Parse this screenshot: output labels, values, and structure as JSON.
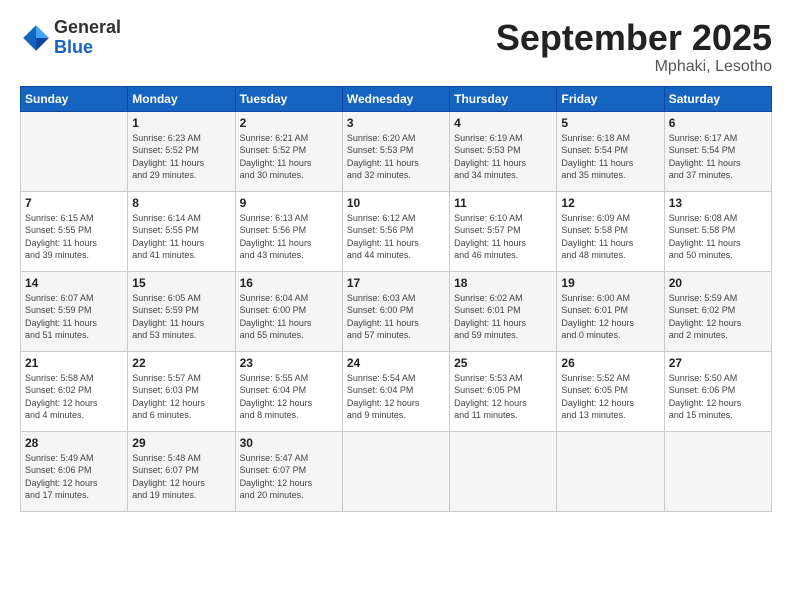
{
  "logo": {
    "general": "General",
    "blue": "Blue"
  },
  "title": "September 2025",
  "location": "Mphaki, Lesotho",
  "days_header": [
    "Sunday",
    "Monday",
    "Tuesday",
    "Wednesday",
    "Thursday",
    "Friday",
    "Saturday"
  ],
  "weeks": [
    [
      {
        "day": "",
        "info": ""
      },
      {
        "day": "1",
        "info": "Sunrise: 6:23 AM\nSunset: 5:52 PM\nDaylight: 11 hours\nand 29 minutes."
      },
      {
        "day": "2",
        "info": "Sunrise: 6:21 AM\nSunset: 5:52 PM\nDaylight: 11 hours\nand 30 minutes."
      },
      {
        "day": "3",
        "info": "Sunrise: 6:20 AM\nSunset: 5:53 PM\nDaylight: 11 hours\nand 32 minutes."
      },
      {
        "day": "4",
        "info": "Sunrise: 6:19 AM\nSunset: 5:53 PM\nDaylight: 11 hours\nand 34 minutes."
      },
      {
        "day": "5",
        "info": "Sunrise: 6:18 AM\nSunset: 5:54 PM\nDaylight: 11 hours\nand 35 minutes."
      },
      {
        "day": "6",
        "info": "Sunrise: 6:17 AM\nSunset: 5:54 PM\nDaylight: 11 hours\nand 37 minutes."
      }
    ],
    [
      {
        "day": "7",
        "info": "Sunrise: 6:15 AM\nSunset: 5:55 PM\nDaylight: 11 hours\nand 39 minutes."
      },
      {
        "day": "8",
        "info": "Sunrise: 6:14 AM\nSunset: 5:55 PM\nDaylight: 11 hours\nand 41 minutes."
      },
      {
        "day": "9",
        "info": "Sunrise: 6:13 AM\nSunset: 5:56 PM\nDaylight: 11 hours\nand 43 minutes."
      },
      {
        "day": "10",
        "info": "Sunrise: 6:12 AM\nSunset: 5:56 PM\nDaylight: 11 hours\nand 44 minutes."
      },
      {
        "day": "11",
        "info": "Sunrise: 6:10 AM\nSunset: 5:57 PM\nDaylight: 11 hours\nand 46 minutes."
      },
      {
        "day": "12",
        "info": "Sunrise: 6:09 AM\nSunset: 5:58 PM\nDaylight: 11 hours\nand 48 minutes."
      },
      {
        "day": "13",
        "info": "Sunrise: 6:08 AM\nSunset: 5:58 PM\nDaylight: 11 hours\nand 50 minutes."
      }
    ],
    [
      {
        "day": "14",
        "info": "Sunrise: 6:07 AM\nSunset: 5:59 PM\nDaylight: 11 hours\nand 51 minutes."
      },
      {
        "day": "15",
        "info": "Sunrise: 6:05 AM\nSunset: 5:59 PM\nDaylight: 11 hours\nand 53 minutes."
      },
      {
        "day": "16",
        "info": "Sunrise: 6:04 AM\nSunset: 6:00 PM\nDaylight: 11 hours\nand 55 minutes."
      },
      {
        "day": "17",
        "info": "Sunrise: 6:03 AM\nSunset: 6:00 PM\nDaylight: 11 hours\nand 57 minutes."
      },
      {
        "day": "18",
        "info": "Sunrise: 6:02 AM\nSunset: 6:01 PM\nDaylight: 11 hours\nand 59 minutes."
      },
      {
        "day": "19",
        "info": "Sunrise: 6:00 AM\nSunset: 6:01 PM\nDaylight: 12 hours\nand 0 minutes."
      },
      {
        "day": "20",
        "info": "Sunrise: 5:59 AM\nSunset: 6:02 PM\nDaylight: 12 hours\nand 2 minutes."
      }
    ],
    [
      {
        "day": "21",
        "info": "Sunrise: 5:58 AM\nSunset: 6:02 PM\nDaylight: 12 hours\nand 4 minutes."
      },
      {
        "day": "22",
        "info": "Sunrise: 5:57 AM\nSunset: 6:03 PM\nDaylight: 12 hours\nand 6 minutes."
      },
      {
        "day": "23",
        "info": "Sunrise: 5:55 AM\nSunset: 6:04 PM\nDaylight: 12 hours\nand 8 minutes."
      },
      {
        "day": "24",
        "info": "Sunrise: 5:54 AM\nSunset: 6:04 PM\nDaylight: 12 hours\nand 9 minutes."
      },
      {
        "day": "25",
        "info": "Sunrise: 5:53 AM\nSunset: 6:05 PM\nDaylight: 12 hours\nand 11 minutes."
      },
      {
        "day": "26",
        "info": "Sunrise: 5:52 AM\nSunset: 6:05 PM\nDaylight: 12 hours\nand 13 minutes."
      },
      {
        "day": "27",
        "info": "Sunrise: 5:50 AM\nSunset: 6:06 PM\nDaylight: 12 hours\nand 15 minutes."
      }
    ],
    [
      {
        "day": "28",
        "info": "Sunrise: 5:49 AM\nSunset: 6:06 PM\nDaylight: 12 hours\nand 17 minutes."
      },
      {
        "day": "29",
        "info": "Sunrise: 5:48 AM\nSunset: 6:07 PM\nDaylight: 12 hours\nand 19 minutes."
      },
      {
        "day": "30",
        "info": "Sunrise: 5:47 AM\nSunset: 6:07 PM\nDaylight: 12 hours\nand 20 minutes."
      },
      {
        "day": "",
        "info": ""
      },
      {
        "day": "",
        "info": ""
      },
      {
        "day": "",
        "info": ""
      },
      {
        "day": "",
        "info": ""
      }
    ]
  ]
}
